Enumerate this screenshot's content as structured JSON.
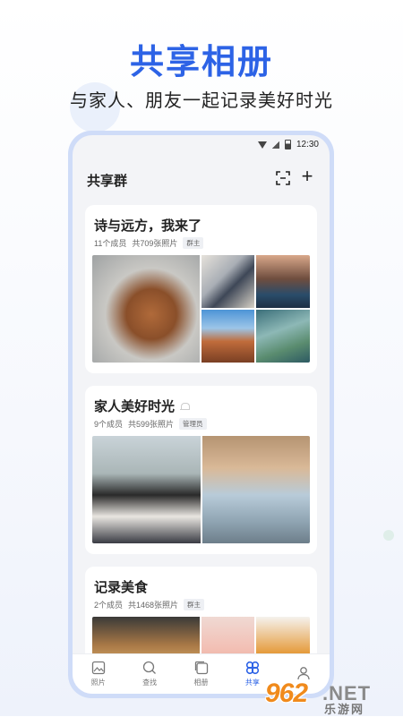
{
  "promo": {
    "headline": "共享相册",
    "subheadline": "与家人、朋友一起记录美好时光"
  },
  "status_bar": {
    "time": "12:30"
  },
  "header": {
    "title": "共享群",
    "scan_icon": "scan-icon",
    "add_label": "+"
  },
  "groups": [
    {
      "title": "诗与远方，我来了",
      "members": "11个成员",
      "photos": "共709张照片",
      "role": "群主",
      "muted": false
    },
    {
      "title": "家人美好时光",
      "members": "9个成员",
      "photos": "共599张照片",
      "role": "管理员",
      "muted": true
    },
    {
      "title": "记录美食",
      "members": "2个成员",
      "photos": "共1468张照片",
      "role": "群主",
      "muted": false
    }
  ],
  "tabs": [
    {
      "label": "照片",
      "icon": "photo-icon",
      "active": false
    },
    {
      "label": "查找",
      "icon": "search-icon",
      "active": false
    },
    {
      "label": "相册",
      "icon": "album-icon",
      "active": false
    },
    {
      "label": "共享",
      "icon": "share-icon",
      "active": true
    },
    {
      "label": "",
      "icon": "profile-icon",
      "active": false
    }
  ],
  "watermark": {
    "number": "962",
    "net": ".NET",
    "site": "乐游网"
  },
  "colors": {
    "accent": "#2d63e6",
    "phone_frame": "#cfdcf8",
    "watermark_orange": "#f08a1c"
  }
}
